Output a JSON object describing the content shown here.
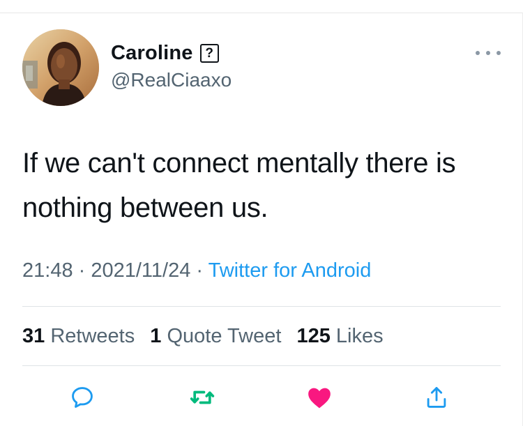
{
  "tweet": {
    "author": {
      "display_name": "Caroline",
      "badge_glyph": "?",
      "handle": "@RealCiaaxo"
    },
    "text": "If we can't connect mentally there is nothing between us.",
    "time": "21:48",
    "date": "2021/11/24",
    "separator": "·",
    "source": "Twitter for Android"
  },
  "stats": {
    "retweets_count": "31",
    "retweets_label": "Retweets",
    "quotes_count": "1",
    "quotes_label": "Quote Tweet",
    "likes_count": "125",
    "likes_label": "Likes"
  },
  "actions": {
    "reply_icon": "reply-bubble-icon",
    "retweet_icon": "retweet-arrows-icon",
    "like_icon": "heart-icon",
    "share_icon": "share-upload-icon",
    "more_icon": "more-dots-icon"
  },
  "colors": {
    "text": "#0f1419",
    "secondary": "#536471",
    "link": "#1d9bf0",
    "retweeted": "#00ba7c",
    "liked": "#f91880",
    "reply_share": "#1d9bf0"
  }
}
